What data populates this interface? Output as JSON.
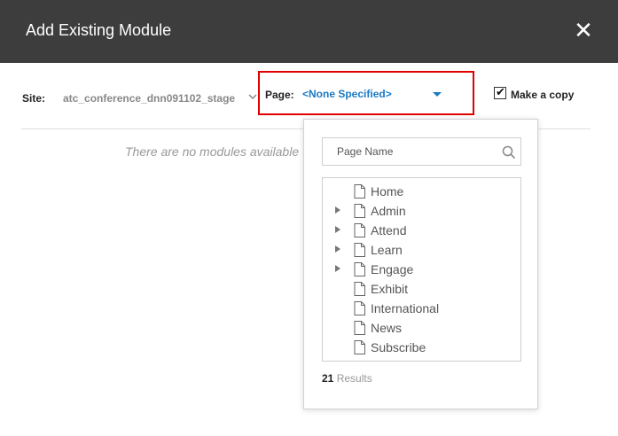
{
  "dialog": {
    "title": "Add Existing Module",
    "close_symbol": "✕"
  },
  "site": {
    "label": "Site:",
    "value": "atc_conference_dnn091102_stage"
  },
  "page": {
    "label": "Page:",
    "selected": "<None Specified>"
  },
  "make_copy": {
    "label": "Make a copy",
    "checked": true
  },
  "empty_message": "There are no modules available",
  "page_dropdown": {
    "search_placeholder": "Page Name",
    "items": [
      {
        "label": "Home",
        "expandable": false
      },
      {
        "label": "Admin",
        "expandable": true
      },
      {
        "label": "Attend",
        "expandable": true
      },
      {
        "label": "Learn",
        "expandable": true
      },
      {
        "label": "Engage",
        "expandable": true
      },
      {
        "label": "Exhibit",
        "expandable": false
      },
      {
        "label": "International",
        "expandable": false
      },
      {
        "label": "News",
        "expandable": false
      },
      {
        "label": "Subscribe",
        "expandable": false
      }
    ],
    "results_count": "21",
    "results_label": "Results"
  },
  "colors": {
    "header_bg": "#3d3d3d",
    "accent_blue": "#1a7ac4",
    "highlight_red": "#e00000"
  }
}
